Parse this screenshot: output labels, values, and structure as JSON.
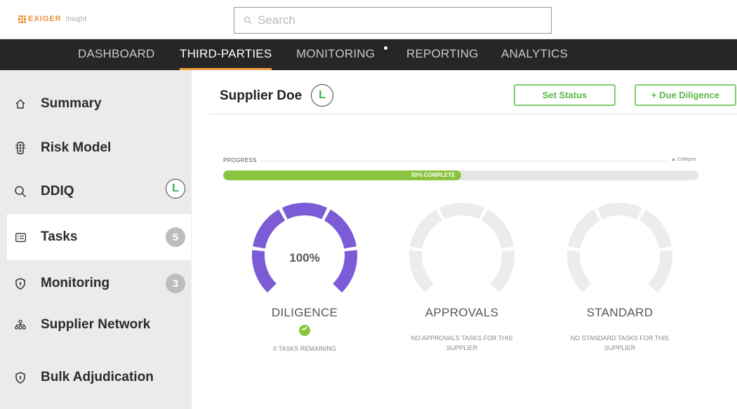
{
  "brand": {
    "name": "EXIGER",
    "product": "Insight"
  },
  "search": {
    "placeholder": "Search"
  },
  "nav": {
    "items": [
      {
        "label": "DASHBOARD"
      },
      {
        "label": "THIRD-PARTIES"
      },
      {
        "label": "MONITORING"
      },
      {
        "label": "REPORTING"
      },
      {
        "label": "ANALYTICS"
      }
    ],
    "active": "THIRD-PARTIES"
  },
  "sidebar": {
    "items": [
      {
        "label": "Summary",
        "icon": "home-icon"
      },
      {
        "label": "Risk Model",
        "icon": "traffic-light-icon"
      },
      {
        "label": "DDIQ",
        "icon": "search-icon",
        "badge": "L"
      },
      {
        "label": "Tasks",
        "icon": "list-icon",
        "badge": "5"
      },
      {
        "label": "Monitoring",
        "icon": "shield-icon",
        "badge": "3"
      },
      {
        "label": "Supplier Network",
        "icon": "network-icon"
      },
      {
        "label": "Bulk Adjudication",
        "icon": "shield-icon"
      }
    ],
    "selected": "Tasks"
  },
  "main": {
    "title": "Supplier Doe",
    "title_badge": "L",
    "set_status_label": "Set Status",
    "due_diligence_label": "+ Due Diligence",
    "progress": {
      "label": "PROGRESS",
      "collapse_label": "▲ Collapse",
      "complete_text": "50% COMPLETE",
      "fraction": 0.5
    },
    "gauges": [
      {
        "name": "DILIGENCE",
        "value": "100%",
        "fraction": 1.0,
        "sub": "0 TASKS REMAINING",
        "done": true
      },
      {
        "name": "APPROVALS",
        "value": "",
        "fraction": 0.0,
        "sub": "NO APPROVALS TASKS FOR THIS SUPPLIER",
        "done": false
      },
      {
        "name": "STANDARD",
        "value": "",
        "fraction": 0.0,
        "sub": "NO STANDARD TASKS FOR THIS SUPPLIER",
        "done": false
      }
    ]
  },
  "colors": {
    "accent_green": "#8bc53f",
    "gauge_purple": "#7b5cd6",
    "gauge_empty": "#ececec",
    "nav_bg": "#262626",
    "nav_active_underline": "#f0a23c"
  }
}
